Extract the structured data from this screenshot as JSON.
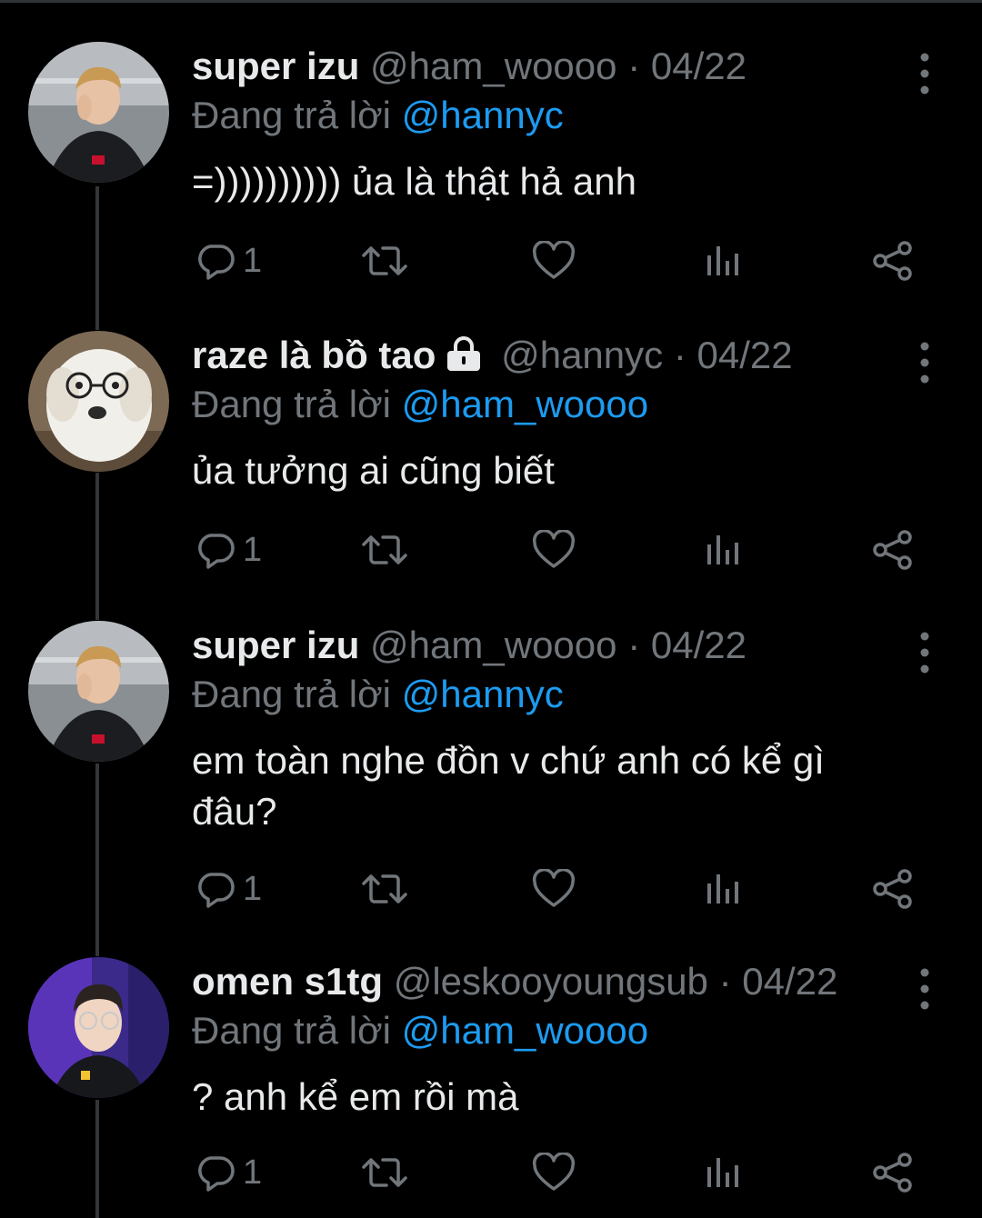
{
  "reply_prefix": "Đang trả lời",
  "tweets": [
    {
      "display_name": "super izu",
      "handle": "@ham_woooo",
      "separator": "·",
      "date": "04/22",
      "replying_to": "@hannyc",
      "text": "=)))))))))) ủa là thật hả anh",
      "reply_count": "1",
      "locked": false
    },
    {
      "display_name": "raze là bồ tao",
      "handle": "@hannyc",
      "separator": "·",
      "date": "04/22",
      "replying_to": "@ham_woooo",
      "text": "ủa tưởng ai cũng biết",
      "reply_count": "1",
      "locked": true
    },
    {
      "display_name": "super izu",
      "handle": "@ham_woooo",
      "separator": "·",
      "date": "04/22",
      "replying_to": "@hannyc",
      "text": "em toàn nghe đồn v chứ anh có kể gì đâu?",
      "reply_count": "1",
      "locked": false
    },
    {
      "display_name": "omen s1tg",
      "handle": "@leskooyoungsub",
      "separator": "·",
      "date": "04/22",
      "replying_to": "@ham_woooo",
      "text": "? anh kể em rồi mà",
      "reply_count": "1",
      "locked": false
    }
  ],
  "icons": {
    "reply": "reply-icon",
    "retweet": "retweet-icon",
    "like": "heart-icon",
    "views": "analytics-icon",
    "share": "share-icon",
    "more": "more-vertical-icon",
    "lock": "lock-icon"
  },
  "colors": {
    "background": "#000000",
    "primary_text": "#e7e9ea",
    "secondary_text": "#71767b",
    "mention": "#1d9bf0",
    "thread_line": "#333639"
  }
}
